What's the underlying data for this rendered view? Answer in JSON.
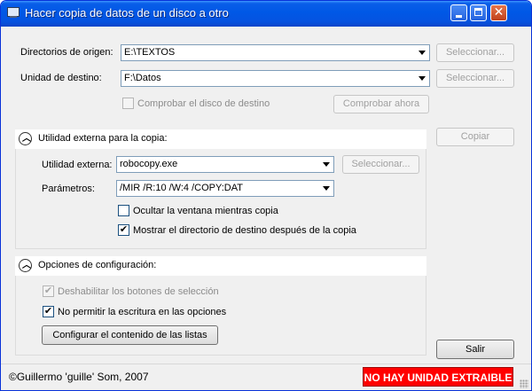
{
  "window": {
    "title": "Hacer copia de datos de un disco a otro"
  },
  "source": {
    "label": "Directorios de origen:",
    "value": "E:\\TEXTOS",
    "select_button": "Seleccionar..."
  },
  "destination": {
    "label": "Unidad de destino:",
    "value": "F:\\Datos",
    "select_button": "Seleccionar...",
    "check_label": "Comprobar el disco de destino",
    "check_now_button": "Comprobar ahora"
  },
  "copy_button": "Copiar",
  "external": {
    "header": "Utilidad externa para la copia:",
    "tool_label": "Utilidad externa:",
    "tool_value": "robocopy.exe",
    "tool_select_button": "Seleccionar...",
    "params_label": "Parámetros:",
    "params_value": "/MIR /R:10 /W:4 /COPY:DAT",
    "hide_window_label": "Ocultar la ventana mientras copia",
    "hide_window_checked": false,
    "show_dest_label": "Mostrar el directorio de destino después de la copia",
    "show_dest_checked": true
  },
  "config": {
    "header": "Opciones de configuración:",
    "disable_select_label": "Deshabilitar los botones de selección",
    "disable_select_checked": true,
    "no_write_label": "No permitir la escritura en las opciones",
    "no_write_checked": true,
    "configure_lists_button": "Configurar el contenido de las listas"
  },
  "exit_button": "Salir",
  "status": {
    "copyright": "©Guillermo 'guille' Som, 2007",
    "alert": "NO HAY UNIDAD EXTRAIBLE",
    "alert_color": "#ff0000"
  },
  "icons": [
    "app-icon",
    "minimize-icon",
    "maximize-icon",
    "close-icon",
    "collapse-icon",
    "dropdown-arrow-icon",
    "checkmark-icon",
    "resize-grip-icon"
  ]
}
